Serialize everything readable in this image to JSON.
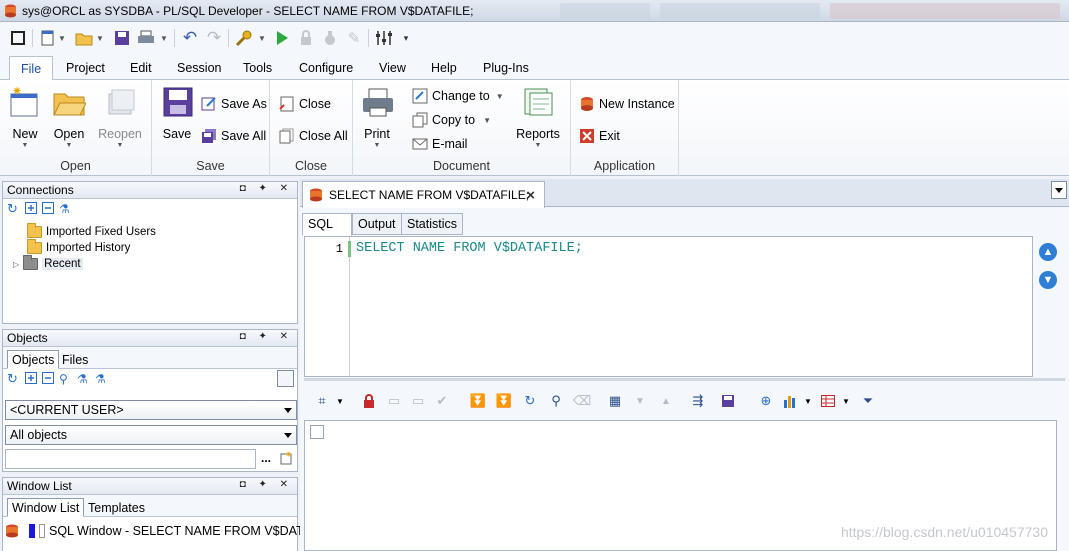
{
  "window": {
    "title": "sys@ORCL as SYSDBA - PL/SQL Developer - SELECT NAME FROM V$DATAFILE;"
  },
  "ribbon_tabs": [
    "File",
    "Project",
    "Edit",
    "Session",
    "Tools",
    "Configure",
    "View",
    "Help",
    "Plug-Ins"
  ],
  "ribbon": {
    "groups": {
      "open": "Open",
      "save": "Save",
      "close": "Close",
      "document": "Document",
      "application": "Application"
    },
    "new": "New",
    "open": "Open",
    "reopen": "Reopen",
    "save": "Save",
    "save_as": "Save As",
    "save_all": "Save All",
    "close": "Close",
    "close_all": "Close All",
    "print": "Print",
    "change_to": "Change to",
    "copy_to": "Copy to",
    "email": "E-mail",
    "reports": "Reports",
    "new_instance": "New Instance",
    "exit": "Exit"
  },
  "connections": {
    "title": "Connections",
    "controls": "◘ ✦ ✕",
    "items": [
      "Imported Fixed Users",
      "Imported History",
      "Recent"
    ]
  },
  "objects": {
    "title": "Objects",
    "controls": "◘ ✦ ✕",
    "tabs": [
      "Objects",
      "Files"
    ],
    "user_select": "<CURRENT USER>",
    "filter_select": "All objects",
    "browse": "..."
  },
  "window_list": {
    "title": "Window List",
    "controls": "◘ ✦ ✕",
    "tabs": [
      "Window List",
      "Templates"
    ],
    "item": "SQL Window - SELECT NAME FROM V$DATAF"
  },
  "document": {
    "tab_title": "SELECT NAME FROM V$DATAFILE;",
    "sub_tabs": [
      "SQL",
      "Output",
      "Statistics"
    ],
    "line_number": "1",
    "code": "SELECT NAME FROM V$DATAFILE;"
  },
  "watermark": "https://blog.csdn.net/u010457730",
  "colors": {
    "accent": "#1f4f9c",
    "sql_keyword": "#1a8a8a",
    "nav_button": "#2e7ed6"
  }
}
